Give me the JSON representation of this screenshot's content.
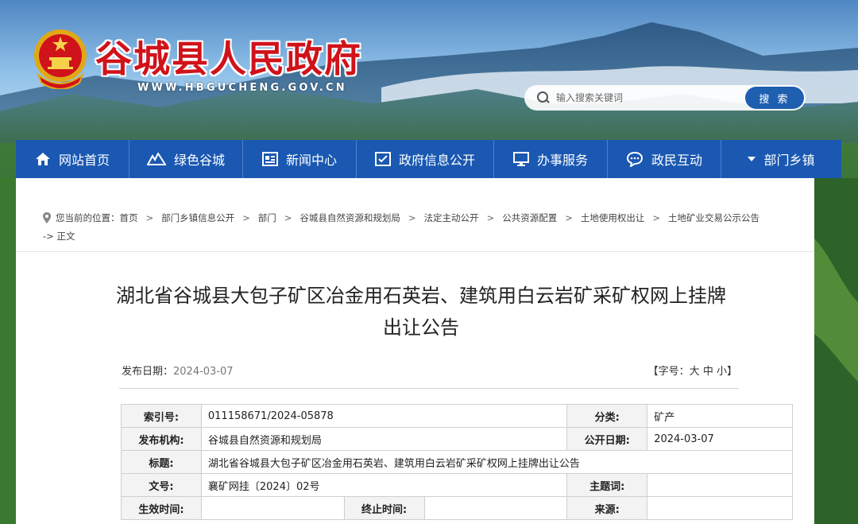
{
  "header": {
    "site_title": "谷城县人民政府",
    "site_url": "WWW.HBGUCHENG.GOV.CN"
  },
  "search": {
    "placeholder": "输入搜索关键词",
    "button_label": "搜 索"
  },
  "nav": {
    "items": [
      {
        "label": "网站首页",
        "icon": "home-icon"
      },
      {
        "label": "绿色谷城",
        "icon": "mountain-icon"
      },
      {
        "label": "新闻中心",
        "icon": "newspaper-icon"
      },
      {
        "label": "政府信息公开",
        "icon": "info-check-icon"
      },
      {
        "label": "办事服务",
        "icon": "monitor-icon"
      },
      {
        "label": "政民互动",
        "icon": "chat-icon"
      },
      {
        "label": "部门乡镇",
        "icon": "caret-down-icon"
      }
    ]
  },
  "breadcrumb": {
    "prefix": "您当前的位置：",
    "items": [
      "首页",
      "部门乡镇信息公开",
      "部门",
      "谷城县自然资源和规划局",
      "法定主动公开",
      "公共资源配置",
      "土地使用权出让",
      "土地矿业交易公示公告"
    ],
    "current": "-> 正文"
  },
  "article": {
    "title": "湖北省谷城县大包子矿区冶金用石英岩、建筑用白云岩矿采矿权网上挂牌出让公告",
    "date_label": "发布日期：",
    "date": "2024-03-07",
    "fontsize_open": "【字号：",
    "fontsize_large": "大",
    "fontsize_medium": "中",
    "fontsize_small": "小",
    "fontsize_close": "】"
  },
  "info_table": {
    "index_label": "索引号:",
    "index_value": "011158671/2024-05878",
    "category_label": "分类:",
    "category_value": "矿产",
    "publisher_label": "发布机构:",
    "publisher_value": "谷城县自然资源和规划局",
    "public_date_label": "公开日期:",
    "public_date_value": "2024-03-07",
    "title_label": "标题:",
    "title_value": "湖北省谷城县大包子矿区冶金用石英岩、建筑用白云岩矿采矿权网上挂牌出让公告",
    "docno_label": "文号:",
    "docno_value": "襄矿网挂〔2024〕02号",
    "subject_label": "主题词:",
    "subject_value": "",
    "effective_label": "生效时间:",
    "effective_value": "",
    "end_label": "终止时间:",
    "end_value": "",
    "source_label": "来源:",
    "source_value": ""
  },
  "colors": {
    "nav_bg": "#1a58b2",
    "title_red": "#d0121a",
    "search_button": "#1f5fb0"
  }
}
